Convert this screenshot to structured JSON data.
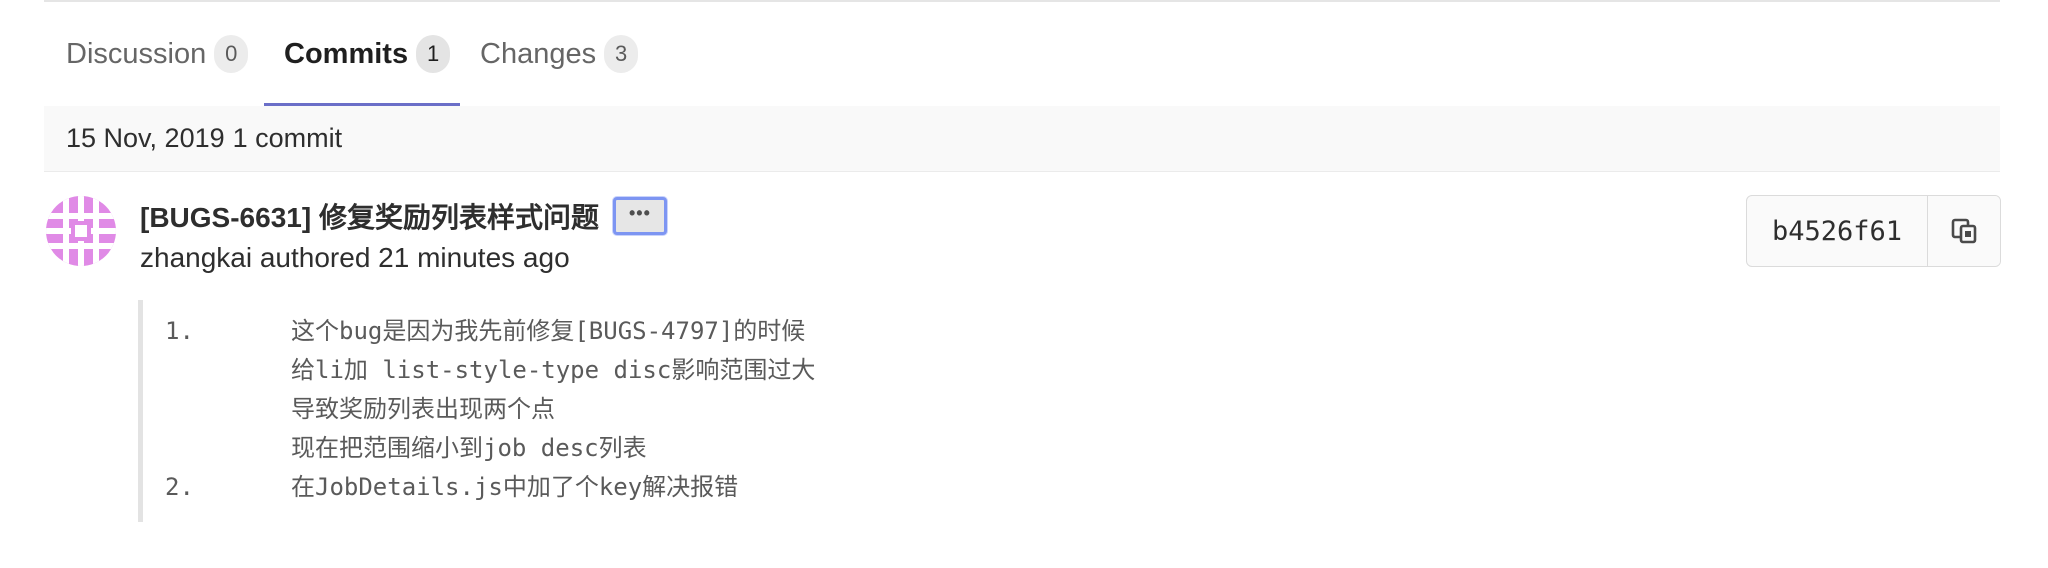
{
  "tabs": [
    {
      "label": "Discussion",
      "count": "0"
    },
    {
      "label": "Commits",
      "count": "1"
    },
    {
      "label": "Changes",
      "count": "3"
    }
  ],
  "day_header": {
    "date": "15 Nov, 2019",
    "count": "1 commit"
  },
  "commit": {
    "title": "[BUGS-6631] 修复奖励列表样式问题",
    "more_button_label": "•••",
    "meta": "zhangkai authored 21 minutes ago",
    "sha": "b4526f61",
    "description": [
      {
        "number": "1.",
        "lines": [
          "这个bug是因为我先前修复[BUGS-4797]的时候",
          "给li加 list-style-type disc影响范围过大",
          "导致奖励列表出现两个点",
          "现在把范围缩小到job desc列表"
        ]
      },
      {
        "number": "2.",
        "lines": [
          "在JobDetails.js中加了个key解决报错"
        ]
      }
    ]
  },
  "colors": {
    "active_tab_underline": "#6b6fc8",
    "avatar": "#e08ae6",
    "focus_ring": "#7d95f2"
  },
  "icons": {
    "avatar": "identicon-avatar",
    "copy": "copy-icon"
  }
}
